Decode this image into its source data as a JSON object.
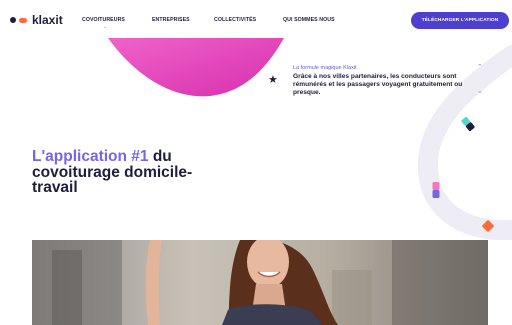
{
  "header": {
    "logo_text": "klaxit",
    "nav": [
      {
        "label": "COVOITUREURS"
      },
      {
        "label": "ENTREPRISES"
      },
      {
        "label": "COLLECTIVITÉS"
      },
      {
        "label": "QUI SOMMES NOUS"
      }
    ],
    "cta_label": "TÉLÉCHARGER L'APPLICATION"
  },
  "info": {
    "label": "La formule magique Klaxit",
    "text": "Grâce à nos villes partenaires, les conducteurs sont rémunérés et les passagers voyagent gratuitement ou presque."
  },
  "headline": {
    "accent": "L'application #1",
    "rest1": " du",
    "line2": "covoiturage domicile-",
    "line3": "travail"
  },
  "colors": {
    "brand_purple": "#4f3fcf",
    "accent_violet": "#7a63e6",
    "pink": "#e83fb8",
    "navy": "#1f1d3d"
  }
}
